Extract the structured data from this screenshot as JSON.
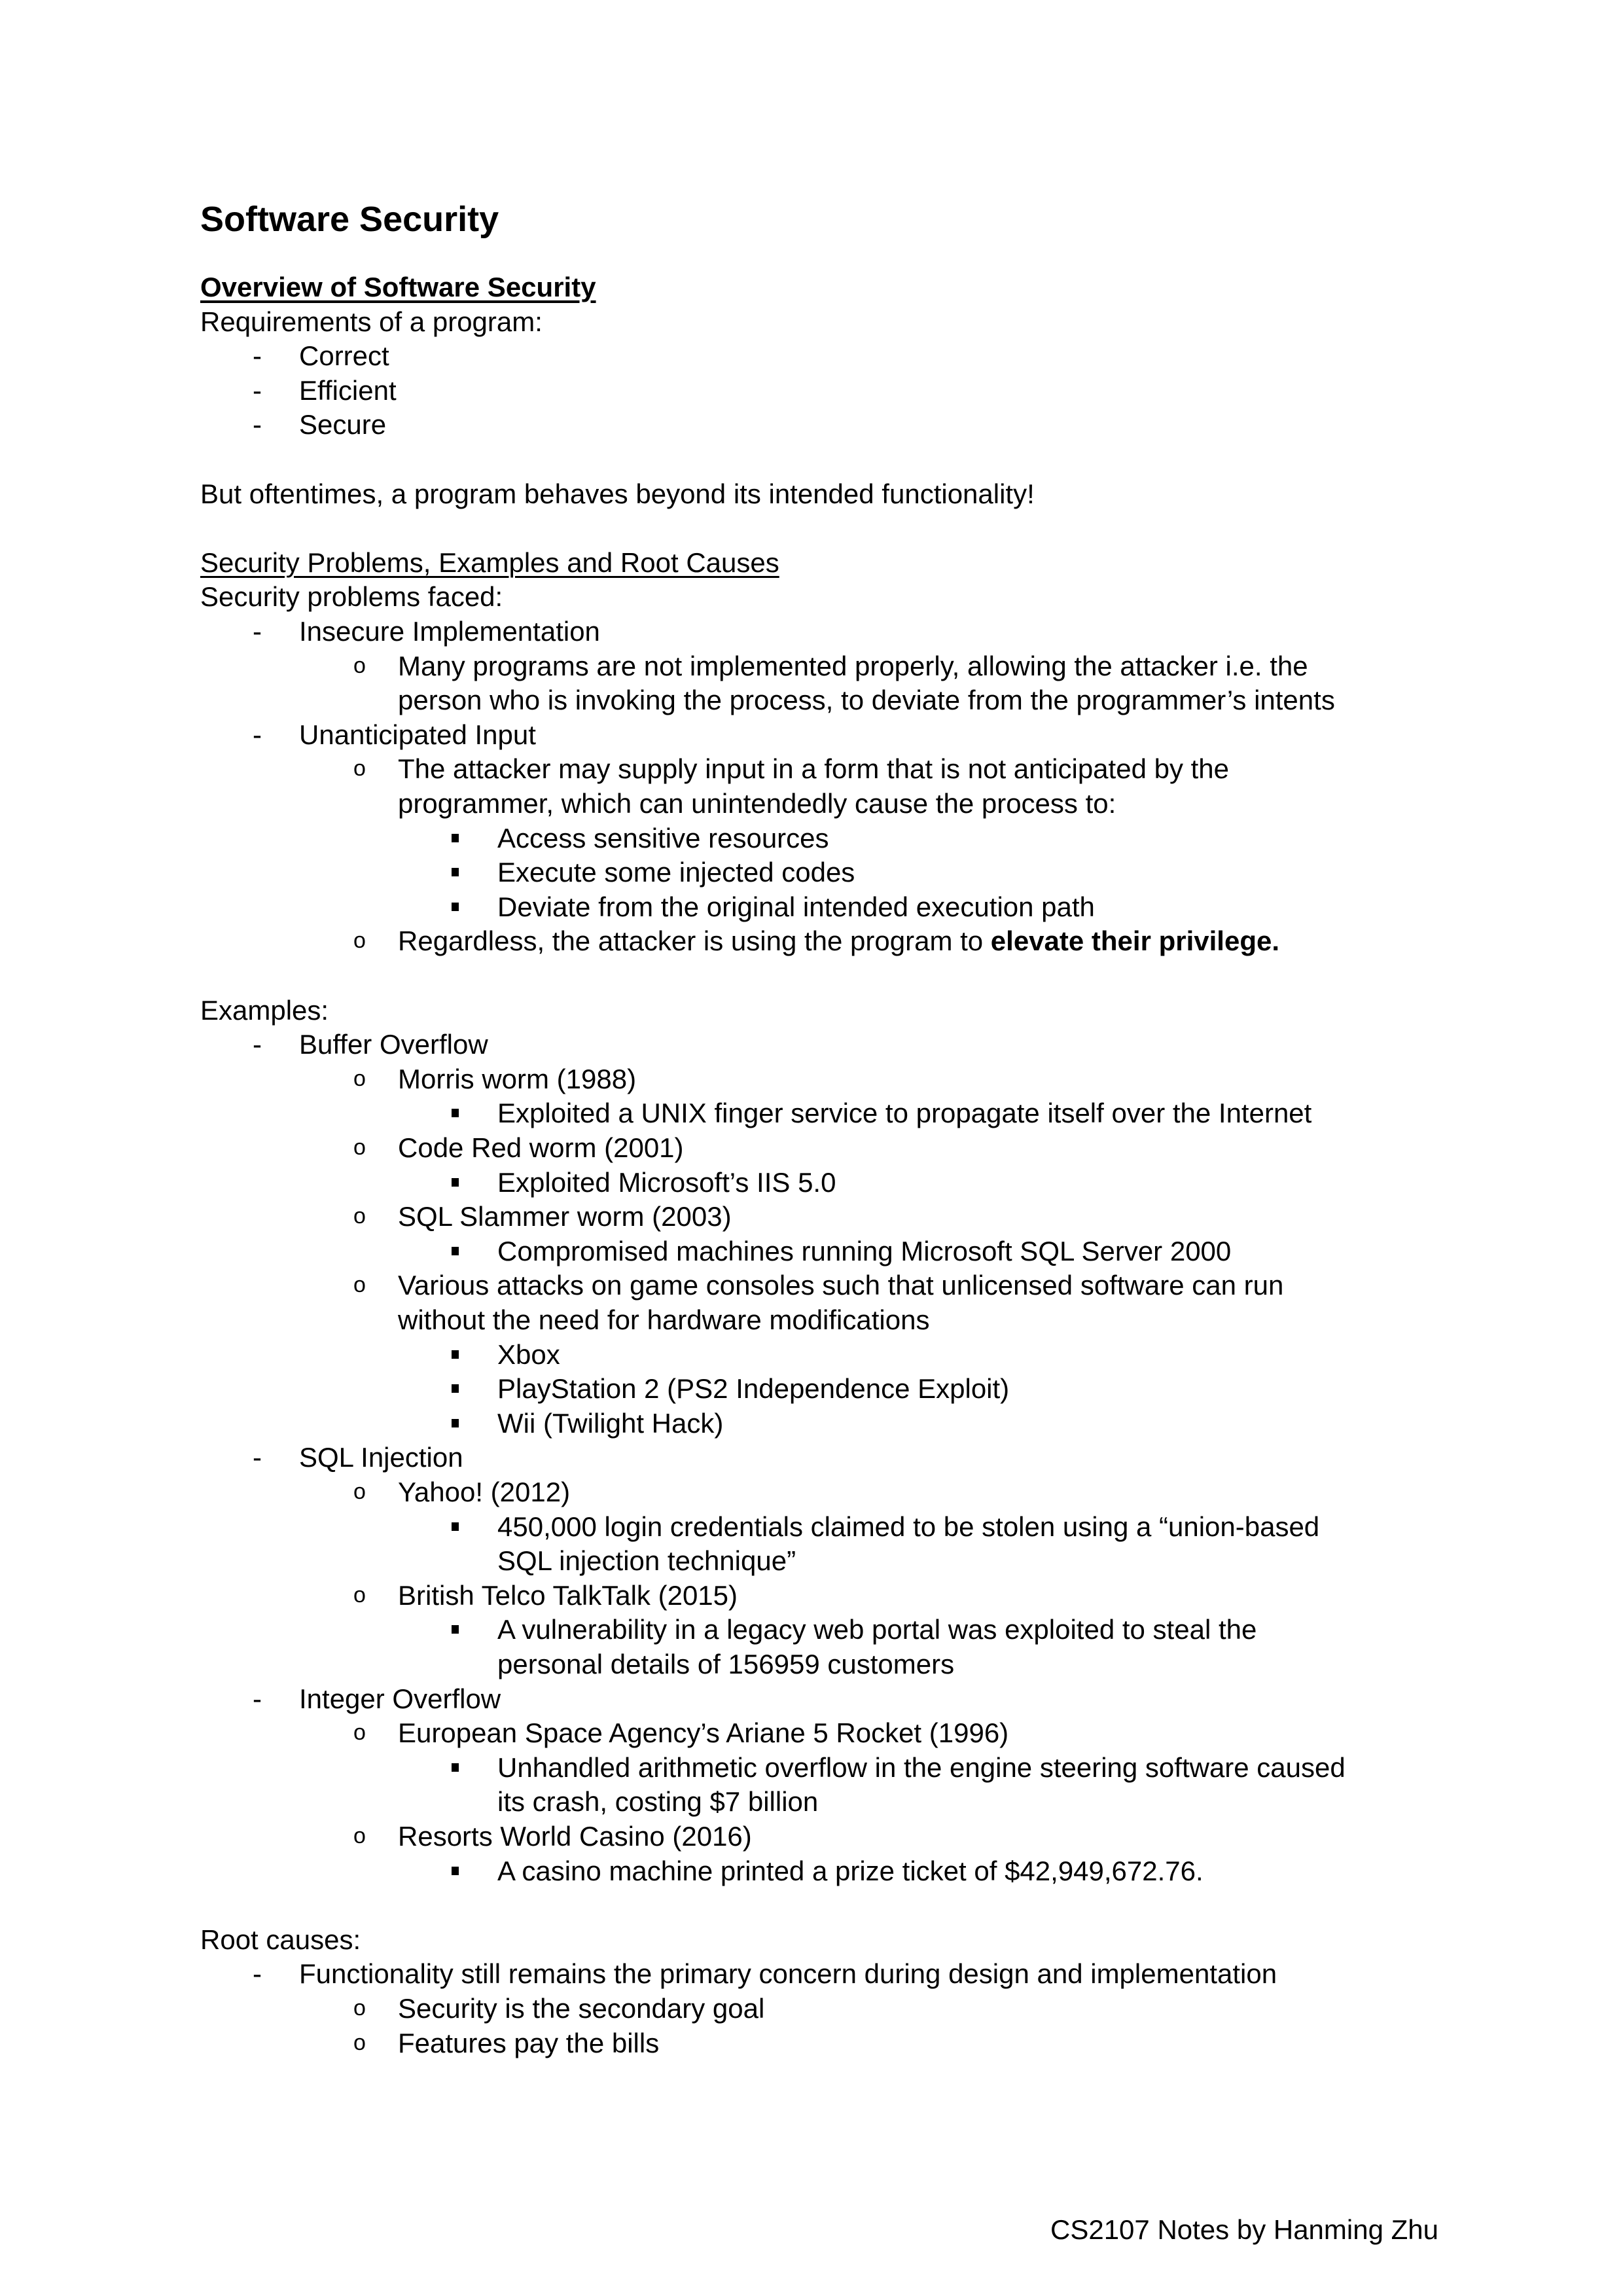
{
  "document": {
    "title": "Software Security",
    "footer": "CS2107 Notes by Hanming Zhu",
    "lines": [
      {
        "level": 0,
        "style": "h2",
        "text": "Overview of Software Security"
      },
      {
        "level": 0,
        "text": "Requirements of a program:"
      },
      {
        "level": 1,
        "marker": "-",
        "text": "Correct"
      },
      {
        "level": 1,
        "marker": "-",
        "text": "Efficient"
      },
      {
        "level": 1,
        "marker": "-",
        "text": "Secure"
      },
      {
        "level": 0,
        "text": ""
      },
      {
        "level": 0,
        "text": "But oftentimes, a program behaves beyond its intended functionality!"
      },
      {
        "level": 0,
        "text": ""
      },
      {
        "level": 0,
        "style": "h3",
        "text": "Security Problems, Examples and Root Causes"
      },
      {
        "level": 0,
        "text": "Security problems faced:"
      },
      {
        "level": 1,
        "marker": "-",
        "text": "Insecure Implementation"
      },
      {
        "level": 2,
        "marker": "o",
        "text": "Many programs are not implemented properly, allowing the attacker i.e. the"
      },
      {
        "level": 2,
        "marker": "",
        "text": "person who is invoking the process, to deviate from the programmer’s intents"
      },
      {
        "level": 1,
        "marker": "-",
        "text": "Unanticipated Input"
      },
      {
        "level": 2,
        "marker": "o",
        "text": "The attacker may supply input in a form that is not anticipated by the"
      },
      {
        "level": 2,
        "marker": "",
        "text": "programmer, which can unintendedly cause the process to:"
      },
      {
        "level": 3,
        "marker": "square",
        "text": "Access sensitive resources"
      },
      {
        "level": 3,
        "marker": "square",
        "text": "Execute some injected codes"
      },
      {
        "level": 3,
        "marker": "square",
        "text": "Deviate from the original intended execution path"
      },
      {
        "level": 2,
        "marker": "o",
        "text": "Regardless, the attacker is using the program to ",
        "bold": "elevate their privilege."
      },
      {
        "level": 0,
        "text": ""
      },
      {
        "level": 0,
        "text": "Examples:"
      },
      {
        "level": 1,
        "marker": "-",
        "text": "Buffer Overflow"
      },
      {
        "level": 2,
        "marker": "o",
        "text": "Morris worm (1988)"
      },
      {
        "level": 3,
        "marker": "square",
        "text": "Exploited a UNIX finger service to propagate itself over the Internet"
      },
      {
        "level": 2,
        "marker": "o",
        "text": "Code Red worm (2001)"
      },
      {
        "level": 3,
        "marker": "square",
        "text": "Exploited Microsoft’s IIS 5.0"
      },
      {
        "level": 2,
        "marker": "o",
        "text": "SQL Slammer worm (2003)"
      },
      {
        "level": 3,
        "marker": "square",
        "text": "Compromised machines running Microsoft SQL Server 2000"
      },
      {
        "level": 2,
        "marker": "o",
        "text": "Various attacks on game consoles such that unlicensed software can run"
      },
      {
        "level": 2,
        "marker": "",
        "text": "without the need for hardware modifications"
      },
      {
        "level": 3,
        "marker": "square",
        "text": "Xbox"
      },
      {
        "level": 3,
        "marker": "square",
        "text": "PlayStation 2 (PS2 Independence Exploit)"
      },
      {
        "level": 3,
        "marker": "square",
        "text": "Wii (Twilight Hack)"
      },
      {
        "level": 1,
        "marker": "-",
        "text": "SQL Injection"
      },
      {
        "level": 2,
        "marker": "o",
        "text": "Yahoo! (2012)"
      },
      {
        "level": 3,
        "marker": "square",
        "text": "450,000 login credentials claimed to be stolen using a “union-based"
      },
      {
        "level": 3,
        "marker": "",
        "text": "SQL injection technique”"
      },
      {
        "level": 2,
        "marker": "o",
        "text": "British Telco TalkTalk (2015)"
      },
      {
        "level": 3,
        "marker": "square",
        "text": "A vulnerability in a legacy web portal was exploited to steal the"
      },
      {
        "level": 3,
        "marker": "",
        "text": "personal details of 156959 customers"
      },
      {
        "level": 1,
        "marker": "-",
        "text": "Integer Overflow"
      },
      {
        "level": 2,
        "marker": "o",
        "text": "European Space Agency’s Ariane 5 Rocket (1996)"
      },
      {
        "level": 3,
        "marker": "square",
        "text": "Unhandled arithmetic overflow in the engine steering software caused"
      },
      {
        "level": 3,
        "marker": "",
        "text": "its crash, costing $7 billion"
      },
      {
        "level": 2,
        "marker": "o",
        "text": "Resorts World Casino (2016)"
      },
      {
        "level": 3,
        "marker": "square",
        "text": "A casino machine printed a prize ticket of $42,949,672.76."
      },
      {
        "level": 0,
        "text": ""
      },
      {
        "level": 0,
        "text": "Root causes:"
      },
      {
        "level": 1,
        "marker": "-",
        "text": "Functionality still remains the primary concern during design and implementation"
      },
      {
        "level": 2,
        "marker": "o",
        "text": "Security is the secondary goal"
      },
      {
        "level": 2,
        "marker": "o",
        "text": "Features pay the bills"
      }
    ]
  }
}
